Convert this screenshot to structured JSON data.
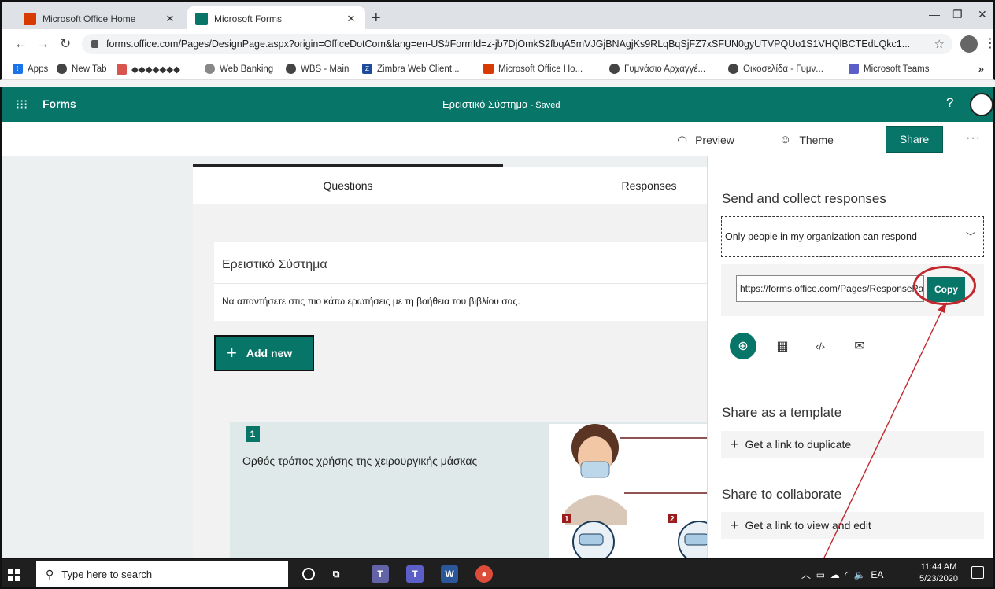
{
  "browser": {
    "tabs": [
      {
        "title": "Microsoft Office Home",
        "icon": "office-icon"
      },
      {
        "title": "Microsoft Forms",
        "icon": "forms-icon"
      }
    ],
    "url": "forms.office.com/Pages/DesignPage.aspx?origin=OfficeDotCom&lang=en-US#FormId=z-jb7DjOmkS2fbqA5mVJGjBNAgjKs9RLqBqSjFZ7xSFUN0gyUTVPQUo1S1VHQlBCTEdLQkc1..."
  },
  "bookmarks": [
    {
      "label": "Apps",
      "icon": "apps-grid-icon"
    },
    {
      "label": "New Tab",
      "icon": "globe-icon"
    },
    {
      "label": "◆◆◆◆◆◆◆",
      "icon": "bookmark-red-icon"
    },
    {
      "label": "Web Banking",
      "icon": "bank-icon"
    },
    {
      "label": "WBS - Main",
      "icon": "globe-icon"
    },
    {
      "label": "Zimbra Web Client...",
      "icon": "zimbra-icon"
    },
    {
      "label": "Microsoft Office Ho...",
      "icon": "office-icon"
    },
    {
      "label": "Γυμνάσιο Αρχαγγέ...",
      "icon": "globe-icon"
    },
    {
      "label": "Οικοσελίδα - Γυμν...",
      "icon": "globe-icon"
    },
    {
      "label": "Microsoft Teams",
      "icon": "teams-icon"
    }
  ],
  "forms_header": {
    "brand": "Forms",
    "doc_title": "Ερειστικό Σύστημα",
    "status": " - Saved",
    "help": "?"
  },
  "commands": {
    "preview": "Preview",
    "theme": "Theme",
    "share": "Share",
    "more": "···"
  },
  "designer": {
    "tab_questions": "Questions",
    "tab_responses": "Responses",
    "form_title": "Ερειστικό Σύστημα",
    "form_description": "Να απαντήσετε στις πιο κάτω ερωτήσεις με τη βοήθεια του βιβλίου σας.",
    "add_new": "Add new",
    "question_number": "1",
    "question_text": "Ορθός τρόπος χρήσης της χειρουργικής μάσκας",
    "image_step_labels": [
      "1",
      "2"
    ]
  },
  "share_panel": {
    "heading": "Send and collect responses",
    "audience": "Only people in my organization can respond",
    "link": "https://forms.office.com/Pages/ResponsePage",
    "copy": "Copy",
    "share_as_template": "Share as a template",
    "duplicate_link": "Get a link to duplicate",
    "share_to_collaborate": "Share to collaborate",
    "view_edit_link": "Get a link to view and edit"
  },
  "taskbar": {
    "search_placeholder": "Type here to search",
    "language": "ΕΑ",
    "time": "11:44 AM",
    "date": "5/23/2020"
  },
  "colors": {
    "brand": "#077568",
    "annotation": "#c1272d"
  }
}
